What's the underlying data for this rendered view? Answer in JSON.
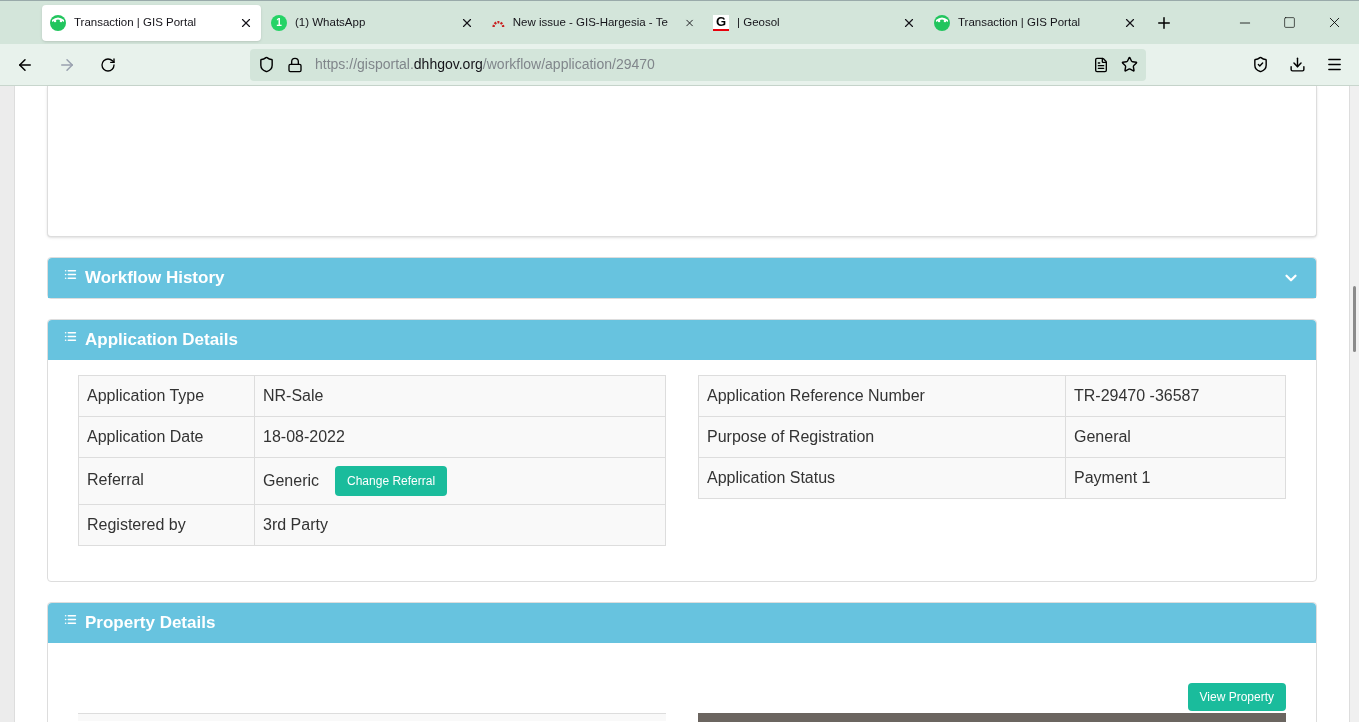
{
  "browser": {
    "tabs": [
      {
        "title": "Transaction | GIS Portal",
        "kind": "portal",
        "selected": true
      },
      {
        "title": "(1) WhatsApp",
        "kind": "chat",
        "selected": false
      },
      {
        "title": "New issue - GIS-Hargesia - Te",
        "kind": "gauge",
        "selected": false
      },
      {
        "title": "| Geosol",
        "kind": "letter",
        "letter": "G",
        "selected": false
      },
      {
        "title": "Transaction | GIS Portal",
        "kind": "portal",
        "selected": false
      }
    ],
    "badge": "1",
    "url": {
      "prefix": "https://gisportal.",
      "domain": "dhhgov.org",
      "path": "/workflow/application/29470"
    }
  },
  "sections": [
    {
      "kind": "collapsed",
      "title": "Workflow History",
      "expanded": false
    },
    {
      "kind": "details",
      "title": "Application Details",
      "left": [
        {
          "label": "Application Type",
          "value": "NR-Sale"
        },
        {
          "label": "Application Date",
          "value": "18-08-2022"
        },
        {
          "label": "Referral",
          "value": "Generic",
          "button": "Change Referral"
        },
        {
          "label": "Registered by",
          "value": "3rd Party"
        }
      ],
      "right": [
        {
          "label": "Application Reference Number",
          "value": "TR-29470 -36587"
        },
        {
          "label": "Purpose of Registration",
          "value": "General"
        },
        {
          "label": "Application Status",
          "value": "Payment 1"
        }
      ]
    },
    {
      "kind": "property",
      "title": "Property Details",
      "button": "View Property"
    }
  ]
}
